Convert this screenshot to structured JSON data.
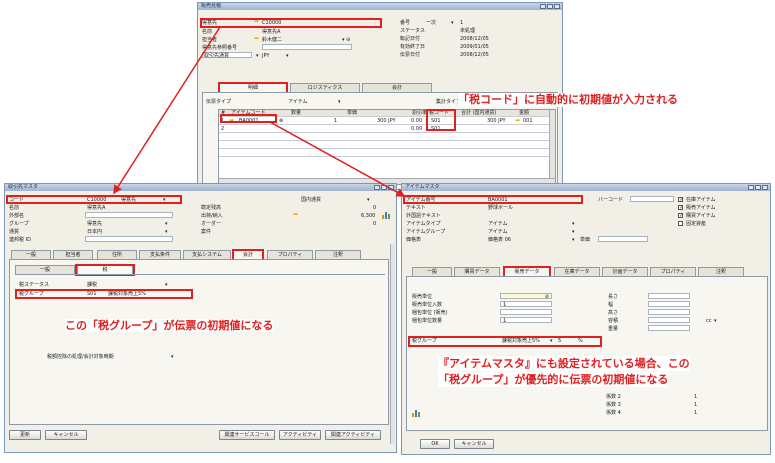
{
  "top": {
    "title": "販売見積",
    "customer_label": "得意先",
    "customer_value": "C10000",
    "name_label": "名前",
    "name_value": "得意先A",
    "contact_label": "担当者",
    "contact_value": "鈴木健二",
    "ref_label": "得意先参照番号",
    "currency_label": "取引先通貨",
    "currency_value": "JPY",
    "no_label": "番号",
    "no_series": "一次",
    "no_value": "1",
    "status_label": "ステータス",
    "status_value": "未処理",
    "post_label": "転記日付",
    "post_value": "2008/12/05",
    "valid_label": "有効終了日",
    "valid_value": "2009/01/05",
    "doc_label": "伝票日付",
    "doc_value": "2008/12/05",
    "tabs": [
      "明細",
      "ロジスティクス",
      "会計"
    ],
    "doctype_label": "伝票タイプ",
    "doctype_value": "アイテム",
    "total_type_label": "集計タイプ",
    "grid_headers": [
      "#",
      "アイテムコード",
      "数量",
      "単価",
      "割引率",
      "税コード",
      "合計 (国内通貨)",
      "金額"
    ],
    "row1": {
      "no": "1",
      "item": "BA0001",
      "qty": "1",
      "price": "300 JPY",
      "disc": "0.00",
      "tax": "S01",
      "total": "300 JPY",
      "amount": "001"
    },
    "row2": {
      "no": "2",
      "disc": "0.00",
      "tax": "S01"
    }
  },
  "bp": {
    "title": "取引先マスタ",
    "code_label": "コード",
    "code_value": "C10000",
    "code_type": "得意先",
    "name_label": "名前",
    "name_value": "得意先A",
    "fname_label": "外部名",
    "group_label": "グループ",
    "group_value": "得意先",
    "currency_label": "通貨",
    "currency_value": "日本円",
    "corp_label": "連邦税 ID",
    "local_label": "国内通貨",
    "balance_label": "勘定残高",
    "balance_value": "0",
    "delivery_label": "出荷/納入",
    "delivery_value": "6,300",
    "orders_label": "オーダー",
    "orders_value": "0",
    "opp_label": "案件",
    "tabs": [
      "一般",
      "担当者",
      "住所",
      "支払条件",
      "支払システム",
      "会計",
      "プロパティ",
      "注釈"
    ],
    "subtabs": [
      "一般",
      "税"
    ],
    "taxstatus_label": "税ステータス",
    "taxstatus_value": "課税",
    "taxgroup_label": "税グループ",
    "taxgroup_code": "S01",
    "taxgroup_name": "課税対象売上5%",
    "deduct_label": "税額控除の処理/会計対象時期",
    "buttons": [
      "更新",
      "キャンセル",
      "関連サービスコール",
      "アクティビティ",
      "関連アクティビティ"
    ]
  },
  "item": {
    "title": "アイテムマスタ",
    "no_label": "アイテム番号",
    "no_value": "BA0001",
    "desc_label": "テキスト",
    "desc_value": "野球ボール",
    "fdesc_label": "外国語テキスト",
    "type_label": "アイテムタイプ",
    "type_value": "アイテム",
    "group_label": "アイテムグループ",
    "group_value": "アイテム",
    "price_label": "価格表",
    "price_value": "価格表 06",
    "unit_label": "単価",
    "barcode_label": "バーコード",
    "checks": [
      "在庫アイテム",
      "販売アイテム",
      "購買アイテム",
      "固定資産"
    ],
    "tabs": [
      "一般",
      "購買データ",
      "販売データ",
      "在庫データ",
      "計画データ",
      "プロパティ",
      "注釈"
    ],
    "sales_unit_label": "販売単位",
    "sales_qty_label": "販売単位入数",
    "sales_qty_value": "1",
    "pack_unit_label": "梱包単位 (販売)",
    "pack_qty_label": "梱包単位数量",
    "pack_qty_value": "1",
    "len_label": "長さ",
    "width_label": "幅",
    "height_label": "高さ",
    "vol_label": "容積",
    "vol_unit": "cc",
    "weight_label": "重量",
    "taxgroup_label": "税グループ",
    "taxgroup_name": "課税対象売上5%",
    "taxgroup_rate": "5",
    "pct": "%",
    "f2_label": "係数 2",
    "f2": "1",
    "f3_label": "係数 3",
    "f3": "1",
    "f4_label": "係数 4",
    "f4": "1",
    "buttons": [
      "OK",
      "キャンセル"
    ]
  },
  "notes": {
    "n1": "「税コード」に自動的に初期値が入力される",
    "n2": "この「税グループ」が伝票の初期値になる",
    "n3a": "『アイテムマスタ』にも設定されている場合、この",
    "n3b": "「税グループ」が優先的に伝票の初期値になる"
  },
  "colors": {
    "accent_red": "#e02020",
    "title_bar": "#9fb3cf",
    "window_bg": "#f1efe6",
    "arrow": "#e8a800"
  }
}
